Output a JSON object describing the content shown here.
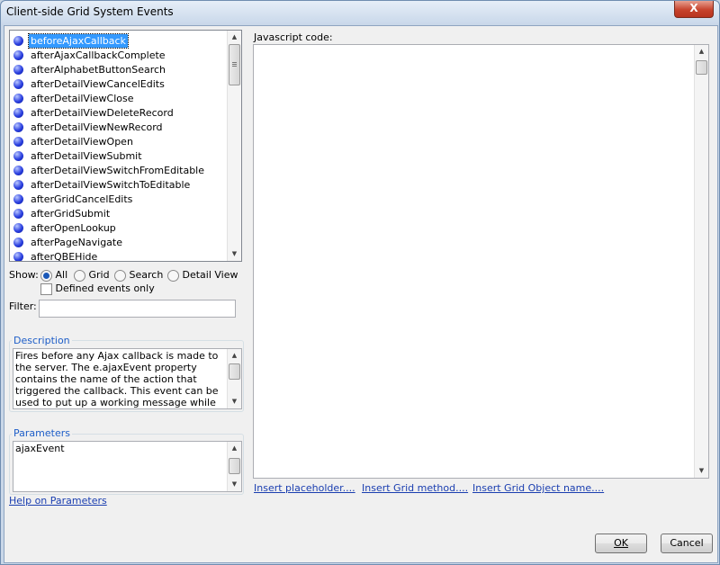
{
  "window": {
    "title": "Client-side Grid System Events",
    "close_glyph": "X"
  },
  "events_list": {
    "items": [
      "beforeAjaxCallback",
      "afterAjaxCallbackComplete",
      "afterAlphabetButtonSearch",
      "afterDetailViewCancelEdits",
      "afterDetailViewClose",
      "afterDetailViewDeleteRecord",
      "afterDetailViewNewRecord",
      "afterDetailViewOpen",
      "afterDetailViewSubmit",
      "afterDetailViewSwitchFromEditable",
      "afterDetailViewSwitchToEditable",
      "afterGridCancelEdits",
      "afterGridSubmit",
      "afterOpenLookup",
      "afterPageNavigate",
      "afterQBEHide"
    ],
    "selected": "beforeAjaxCallback"
  },
  "show": {
    "label": "Show:",
    "options": [
      "All",
      "Grid",
      "Search",
      "Detail View"
    ],
    "selected": "All",
    "defined_only_label": "Defined events only"
  },
  "filter": {
    "label": "Filter:",
    "value": ""
  },
  "description": {
    "label": "Description",
    "text": "Fires before any Ajax callback is made to the server. The e.ajaxEvent property contains the name of the action that triggered the callback. This event can be used to put up a working message while the callback is executing."
  },
  "parameters": {
    "label": "Parameters",
    "text": "ajaxEvent"
  },
  "help_link": "Help on Parameters",
  "code": {
    "label": "Javascript code:",
    "value": ""
  },
  "insert_links": [
    "Insert placeholder....",
    "Insert Grid method....",
    "Insert Grid Object name...."
  ],
  "buttons": {
    "ok": "OK",
    "cancel": "Cancel"
  },
  "icons": {
    "event": "blue-dot-icon",
    "scroll_up": "scroll-up-icon",
    "scroll_down": "scroll-down-icon"
  }
}
